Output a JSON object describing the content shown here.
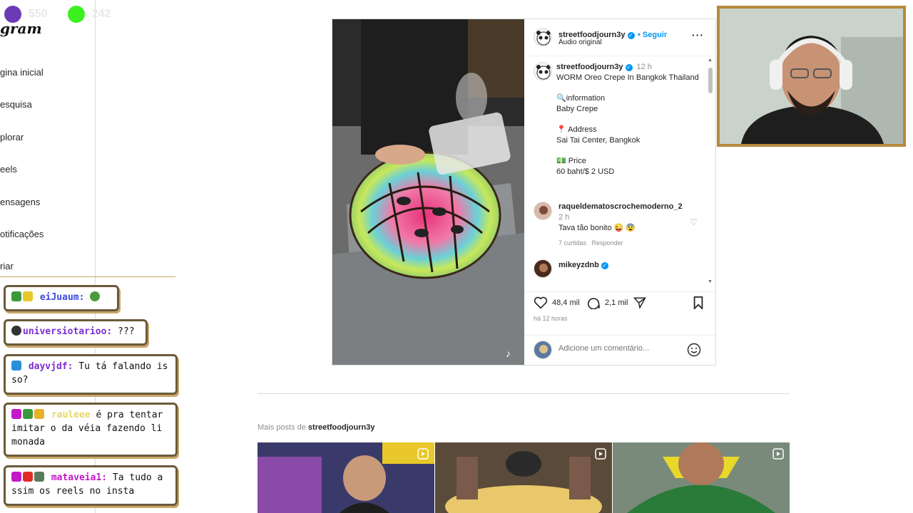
{
  "stream": {
    "stat1": "550",
    "stat2": "242",
    "stat1_color": "#6a3bb5",
    "stat2_color": "#3cf01e"
  },
  "sidebar": {
    "brand": "gram",
    "items": [
      {
        "label": "gina inicial"
      },
      {
        "label": "esquisa"
      },
      {
        "label": "plorar"
      },
      {
        "label": "eels"
      },
      {
        "label": "ensagens"
      },
      {
        "label": "otificações"
      },
      {
        "label": "riar"
      }
    ]
  },
  "chat": [
    {
      "user": "eiJuaum:",
      "text": "",
      "color": "blue"
    },
    {
      "user": "universiotarioo:",
      "text": " ???",
      "color": "purple"
    },
    {
      "user": "dayvjdf:",
      "text": " Tu tá falando is so?",
      "color": "purple"
    },
    {
      "user": "rauleee",
      "text": " é pra tentar imitar o da véia fazendo li monada",
      "color": "yellow"
    },
    {
      "user": "mataveia1:",
      "text": " Ta tudo a ssim os reels no insta",
      "color": "pink"
    }
  ],
  "post": {
    "username": "streetfoodjourn3y",
    "follow": "Seguir",
    "audio": "Áudio original",
    "caption_time": "12 h",
    "caption_title": "WORM Oreo Crepe In Bangkok Thailand",
    "info_label": "information",
    "info_value": "Baby Crepe",
    "address_label": "Address",
    "address_value": "Sai Tai Center, Bangkok",
    "price_label": "Price",
    "price_value": "60 baht/$ 2 USD",
    "comments": [
      {
        "user": "raqueldematoscrochemoderno_2",
        "time": "2 h",
        "text": "Tava tão bonito 😜 😨",
        "likes": "7 curtidas",
        "reply": "Responder"
      },
      {
        "user": "mikeyzdnb",
        "time": "",
        "text": "",
        "likes": "",
        "reply": ""
      }
    ],
    "likes": "48,4 mil",
    "comment_count": "2,1 mil",
    "posted": "há 12 horas",
    "add_comment_placeholder": "Adicione um comentário..."
  },
  "more": {
    "prefix": "Mais posts de ",
    "user": "streetfoodjourn3y"
  },
  "icons": [
    "heart-icon",
    "comment-icon",
    "share-icon",
    "bookmark-icon",
    "emoji-icon",
    "more-options-icon",
    "reel-icon",
    "verified-icon"
  ]
}
